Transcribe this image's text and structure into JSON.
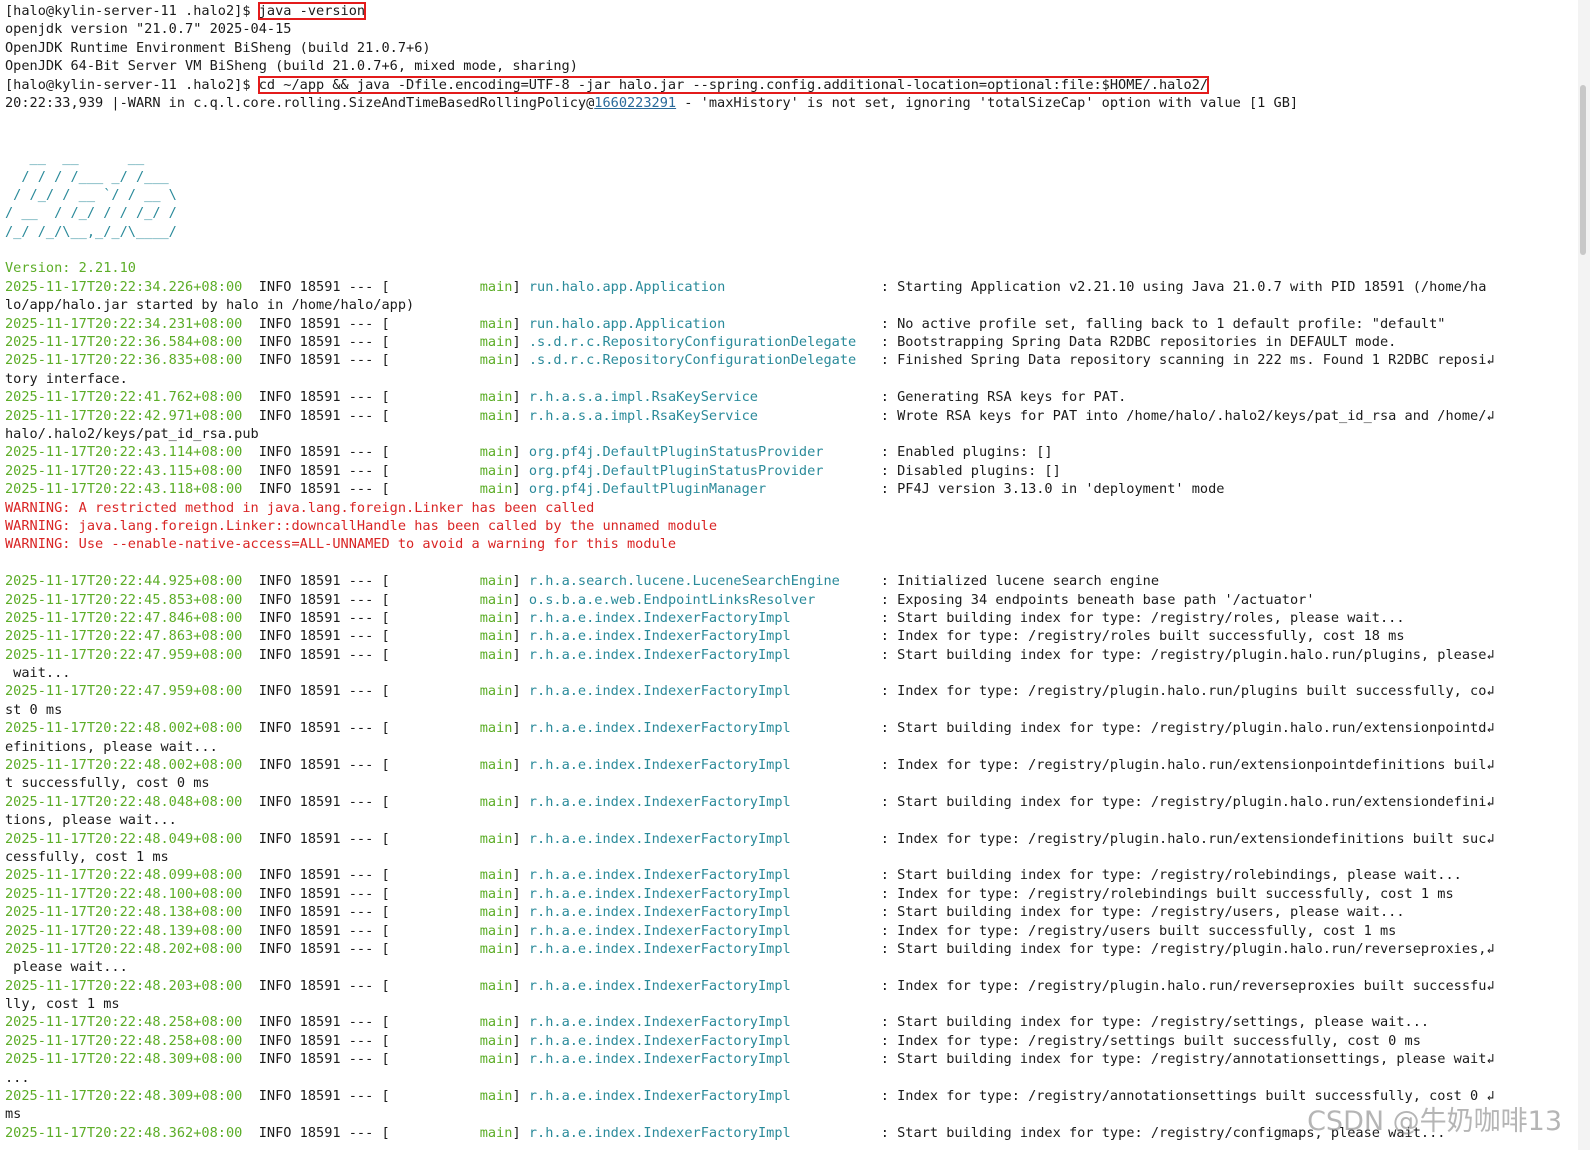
{
  "terminal": {
    "prompt": "[halo@kylin-server-11 .halo2]$ ",
    "cmd1": "java -version",
    "ver_lines": [
      "openjdk version \"21.0.7\" 2025-04-15",
      "OpenJDK Runtime Environment BiSheng (build 21.0.7+6)",
      "OpenJDK 64-Bit Server VM BiSheng (build 21.0.7+6, mixed mode, sharing)"
    ],
    "cmd2": "cd ~/app && java -Dfile.encoding=UTF-8 -jar halo.jar --spring.config.additional-location=optional:file:$HOME/.halo2/",
    "warn_line": {
      "prefix": "20:22:33,939 |-WARN in c.q.l.core.rolling.SizeAndTimeBasedRollingPolicy@",
      "id": "1660223291",
      "suffix": " - 'maxHistory' is not set, ignoring 'totalSizeCap' option with value [1 GB]"
    },
    "banner": [
      "   __  __      __",
      "  / / / /___ _/ /___",
      " / /_/ / __ `/ / __ \\",
      "/ __  / /_/ / / /_/ /",
      "/_/ /_/\\__,_/_/\\____/"
    ],
    "version_label": "Version: 2.21.10",
    "log_head": "INFO 18591 --- [",
    "lines": [
      {
        "t": "log",
        "ts": "2025-11-17T20:22:34.226+08:00",
        "th": "main",
        "logger": "run.halo.app.Application                   ",
        "msg": ": Starting Application v2.21.10 using Java 21.0.7 with PID 18591 (/home/ha"
      },
      {
        "t": "cont",
        "text": "lo/app/halo.jar started by halo in /home/halo/app)"
      },
      {
        "t": "log",
        "ts": "2025-11-17T20:22:34.231+08:00",
        "th": "main",
        "logger": "run.halo.app.Application                   ",
        "msg": ": No active profile set, falling back to 1 default profile: \"default\""
      },
      {
        "t": "log",
        "ts": "2025-11-17T20:22:36.584+08:00",
        "th": "main",
        "logger": ".s.d.r.c.RepositoryConfigurationDelegate   ",
        "msg": ": Bootstrapping Spring Data R2DBC repositories in DEFAULT mode."
      },
      {
        "t": "log",
        "ts": "2025-11-17T20:22:36.835+08:00",
        "th": "main",
        "logger": ".s.d.r.c.RepositoryConfigurationDelegate   ",
        "msg": ": Finished Spring Data repository scanning in 222 ms. Found 1 R2DBC reposi↲"
      },
      {
        "t": "cont",
        "text": "tory interface."
      },
      {
        "t": "log",
        "ts": "2025-11-17T20:22:41.762+08:00",
        "th": "main",
        "logger": "r.h.a.s.a.impl.RsaKeyService               ",
        "msg": ": Generating RSA keys for PAT."
      },
      {
        "t": "log",
        "ts": "2025-11-17T20:22:42.971+08:00",
        "th": "main",
        "logger": "r.h.a.s.a.impl.RsaKeyService               ",
        "msg": ": Wrote RSA keys for PAT into /home/halo/.halo2/keys/pat_id_rsa and /home/↲"
      },
      {
        "t": "cont",
        "text": "halo/.halo2/keys/pat_id_rsa.pub"
      },
      {
        "t": "log",
        "ts": "2025-11-17T20:22:43.114+08:00",
        "th": "main",
        "logger": "org.pf4j.DefaultPluginStatusProvider       ",
        "msg": ": Enabled plugins: []"
      },
      {
        "t": "log",
        "ts": "2025-11-17T20:22:43.115+08:00",
        "th": "main",
        "logger": "org.pf4j.DefaultPluginStatusProvider       ",
        "msg": ": Disabled plugins: []"
      },
      {
        "t": "log",
        "ts": "2025-11-17T20:22:43.118+08:00",
        "th": "main",
        "logger": "org.pf4j.DefaultPluginManager              ",
        "msg": ": PF4J version 3.13.0 in 'deployment' mode"
      },
      {
        "t": "warn",
        "text": "WARNING: A restricted method in java.lang.foreign.Linker has been called"
      },
      {
        "t": "warn",
        "text": "WARNING: java.lang.foreign.Linker::downcallHandle has been called by the unnamed module"
      },
      {
        "t": "warn",
        "text": "WARNING: Use --enable-native-access=ALL-UNNAMED to avoid a warning for this module"
      },
      {
        "t": "blank",
        "text": ""
      },
      {
        "t": "log",
        "ts": "2025-11-17T20:22:44.925+08:00",
        "th": "main",
        "logger": "r.h.a.search.lucene.LuceneSearchEngine     ",
        "msg": ": Initialized lucene search engine"
      },
      {
        "t": "log",
        "ts": "2025-11-17T20:22:45.853+08:00",
        "th": "main",
        "logger": "o.s.b.a.e.web.EndpointLinksResolver        ",
        "msg": ": Exposing 34 endpoints beneath base path '/actuator'"
      },
      {
        "t": "log",
        "ts": "2025-11-17T20:22:47.846+08:00",
        "th": "main",
        "logger": "r.h.a.e.index.IndexerFactoryImpl           ",
        "msg": ": Start building index for type: /registry/roles, please wait..."
      },
      {
        "t": "log",
        "ts": "2025-11-17T20:22:47.863+08:00",
        "th": "main",
        "logger": "r.h.a.e.index.IndexerFactoryImpl           ",
        "msg": ": Index for type: /registry/roles built successfully, cost 18 ms"
      },
      {
        "t": "log",
        "ts": "2025-11-17T20:22:47.959+08:00",
        "th": "main",
        "logger": "r.h.a.e.index.IndexerFactoryImpl           ",
        "msg": ": Start building index for type: /registry/plugin.halo.run/plugins, please↲"
      },
      {
        "t": "cont",
        "text": " wait..."
      },
      {
        "t": "log",
        "ts": "2025-11-17T20:22:47.959+08:00",
        "th": "main",
        "logger": "r.h.a.e.index.IndexerFactoryImpl           ",
        "msg": ": Index for type: /registry/plugin.halo.run/plugins built successfully, co↲"
      },
      {
        "t": "cont",
        "text": "st 0 ms"
      },
      {
        "t": "log",
        "ts": "2025-11-17T20:22:48.002+08:00",
        "th": "main",
        "logger": "r.h.a.e.index.IndexerFactoryImpl           ",
        "msg": ": Start building index for type: /registry/plugin.halo.run/extensionpointd↲"
      },
      {
        "t": "cont",
        "text": "efinitions, please wait..."
      },
      {
        "t": "log",
        "ts": "2025-11-17T20:22:48.002+08:00",
        "th": "main",
        "logger": "r.h.a.e.index.IndexerFactoryImpl           ",
        "msg": ": Index for type: /registry/plugin.halo.run/extensionpointdefinitions buil↲"
      },
      {
        "t": "cont",
        "text": "t successfully, cost 0 ms"
      },
      {
        "t": "log",
        "ts": "2025-11-17T20:22:48.048+08:00",
        "th": "main",
        "logger": "r.h.a.e.index.IndexerFactoryImpl           ",
        "msg": ": Start building index for type: /registry/plugin.halo.run/extensiondefini↲"
      },
      {
        "t": "cont",
        "text": "tions, please wait..."
      },
      {
        "t": "log",
        "ts": "2025-11-17T20:22:48.049+08:00",
        "th": "main",
        "logger": "r.h.a.e.index.IndexerFactoryImpl           ",
        "msg": ": Index for type: /registry/plugin.halo.run/extensiondefinitions built suc↲"
      },
      {
        "t": "cont",
        "text": "cessfully, cost 1 ms"
      },
      {
        "t": "log",
        "ts": "2025-11-17T20:22:48.099+08:00",
        "th": "main",
        "logger": "r.h.a.e.index.IndexerFactoryImpl           ",
        "msg": ": Start building index for type: /registry/rolebindings, please wait..."
      },
      {
        "t": "log",
        "ts": "2025-11-17T20:22:48.100+08:00",
        "th": "main",
        "logger": "r.h.a.e.index.IndexerFactoryImpl           ",
        "msg": ": Index for type: /registry/rolebindings built successfully, cost 1 ms"
      },
      {
        "t": "log",
        "ts": "2025-11-17T20:22:48.138+08:00",
        "th": "main",
        "logger": "r.h.a.e.index.IndexerFactoryImpl           ",
        "msg": ": Start building index for type: /registry/users, please wait..."
      },
      {
        "t": "log",
        "ts": "2025-11-17T20:22:48.139+08:00",
        "th": "main",
        "logger": "r.h.a.e.index.IndexerFactoryImpl           ",
        "msg": ": Index for type: /registry/users built successfully, cost 1 ms"
      },
      {
        "t": "log",
        "ts": "2025-11-17T20:22:48.202+08:00",
        "th": "main",
        "logger": "r.h.a.e.index.IndexerFactoryImpl           ",
        "msg": ": Start building index for type: /registry/plugin.halo.run/reverseproxies,↲"
      },
      {
        "t": "cont",
        "text": " please wait..."
      },
      {
        "t": "log",
        "ts": "2025-11-17T20:22:48.203+08:00",
        "th": "main",
        "logger": "r.h.a.e.index.IndexerFactoryImpl           ",
        "msg": ": Index for type: /registry/plugin.halo.run/reverseproxies built successfu↲"
      },
      {
        "t": "cont",
        "text": "lly, cost 1 ms"
      },
      {
        "t": "log",
        "ts": "2025-11-17T20:22:48.258+08:00",
        "th": "main",
        "logger": "r.h.a.e.index.IndexerFactoryImpl           ",
        "msg": ": Start building index for type: /registry/settings, please wait..."
      },
      {
        "t": "log",
        "ts": "2025-11-17T20:22:48.258+08:00",
        "th": "main",
        "logger": "r.h.a.e.index.IndexerFactoryImpl           ",
        "msg": ": Index for type: /registry/settings built successfully, cost 0 ms"
      },
      {
        "t": "log",
        "ts": "2025-11-17T20:22:48.309+08:00",
        "th": "main",
        "logger": "r.h.a.e.index.IndexerFactoryImpl           ",
        "msg": ": Start building index for type: /registry/annotationsettings, please wait↲"
      },
      {
        "t": "cont",
        "text": "..."
      },
      {
        "t": "log",
        "ts": "2025-11-17T20:22:48.309+08:00",
        "th": "main",
        "logger": "r.h.a.e.index.IndexerFactoryImpl           ",
        "msg": ": Index for type: /registry/annotationsettings built successfully, cost 0 ↲"
      },
      {
        "t": "cont",
        "text": "ms"
      },
      {
        "t": "log",
        "ts": "2025-11-17T20:22:48.362+08:00",
        "th": "main",
        "logger": "r.h.a.e.index.IndexerFactoryImpl           ",
        "msg": ": Start building index for type: /registry/configmaps, please wait..."
      }
    ]
  },
  "watermark": "CSDN @牛奶咖啡13"
}
